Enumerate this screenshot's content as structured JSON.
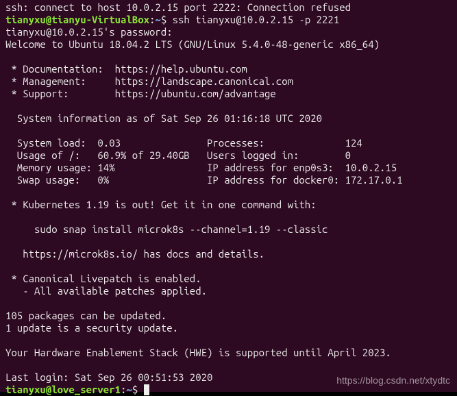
{
  "line0": "ssh: connect to host 10.0.2.15 port 2222: Connection refused",
  "prompt1_user": "tianyxu@tianyu-VirtualBox",
  "prompt1_path": "~",
  "prompt1_cmd": "$ ssh tianyxu@10.0.2.15 -p 2221",
  "pw_line": "tianyxu@10.0.2.15's password: ",
  "welcome": "Welcome to Ubuntu 18.04.2 LTS (GNU/Linux 5.4.0-48-generic x86_64)",
  "blank": "",
  "doc_line": " * Documentation:  https://help.ubuntu.com",
  "mgmt_line": " * Management:     https://landscape.canonical.com",
  "sup_line": " * Support:        https://ubuntu.com/advantage",
  "sysinfo_hdr": "  System information as of Sat Sep 26 01:16:18 UTC 2020",
  "sys_load": "  System load:  0.03               Processes:              124",
  "disk_usage": "  Usage of /:   60.9% of 29.40GB   Users logged in:        0",
  "mem_usage": "  Memory usage: 14%                IP address for enp0s3:  10.0.2.15",
  "swap_usage": "  Swap usage:   0%                 IP address for docker0: 172.17.0.1",
  "k8s_line": " * Kubernetes 1.19 is out! Get it in one command with:",
  "k8s_cmd": "     sudo snap install microk8s --channel=1.19 --classic",
  "k8s_docs": "   https://microk8s.io/ has docs and details.",
  "livepatch1": " * Canonical Livepatch is enabled.",
  "livepatch2": "   - All available patches applied.",
  "updates1": "105 packages can be updated.",
  "updates2": "1 update is a security update.",
  "hwe": "Your Hardware Enablement Stack (HWE) is supported until April 2023.",
  "lastlogin": "Last login: Sat Sep 26 00:51:53 2020",
  "prompt2_user": "tianyxu@love_server1",
  "prompt2_path": "~",
  "prompt2_cmd": "$ ",
  "watermark": "https://blog.csdn.net/xtydtc"
}
